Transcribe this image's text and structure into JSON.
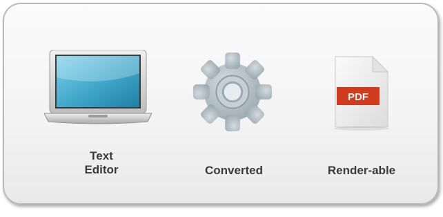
{
  "steps": [
    {
      "icon": "laptop-icon",
      "label_line1": "Text",
      "label_line2": "Editor"
    },
    {
      "icon": "gear-icon",
      "label": "Converted"
    },
    {
      "icon": "pdf-file-icon",
      "badge": "PDF",
      "label": "Render-able"
    }
  ],
  "colors": {
    "panel_border": "#b9b9b9",
    "label_text": "#3a3a3a",
    "screen_blue": "#3fa6c9",
    "gear_gray": "#a9b6bd",
    "pdf_red": "#d23a1e"
  }
}
